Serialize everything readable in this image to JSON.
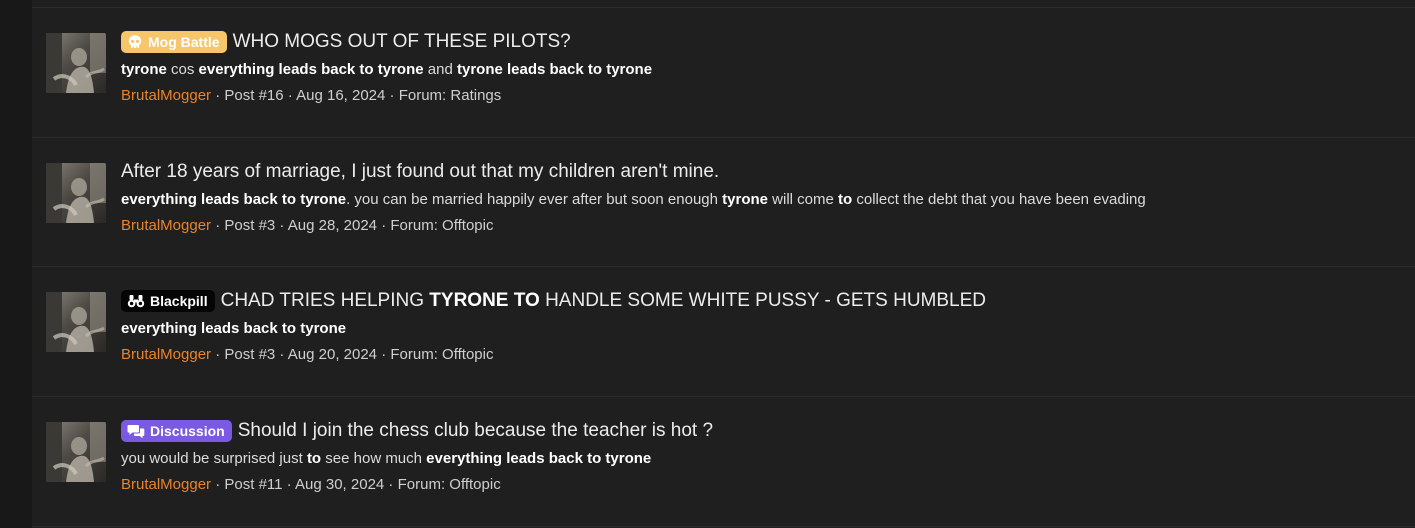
{
  "results": [
    {
      "badge": {
        "label": "Mog Battle",
        "icon": "skull-icon",
        "color": "#f7c66a"
      },
      "title_parts": [
        {
          "text": "WHO MOGS OUT OF THESE PILOTS?",
          "bold": false
        }
      ],
      "snippet_parts": [
        {
          "text": "tyrone",
          "bold": true
        },
        {
          "text": " cos ",
          "bold": false
        },
        {
          "text": "everything leads back to tyrone",
          "bold": true
        },
        {
          "text": " and ",
          "bold": false
        },
        {
          "text": "tyrone leads back to tyrone",
          "bold": true
        }
      ],
      "author": "BrutalMogger",
      "post": "Post #16",
      "date": "Aug 16, 2024",
      "forum": "Forum: Ratings"
    },
    {
      "badge": null,
      "title_parts": [
        {
          "text": "After 18 years of marriage, I just found out that my children aren't mine.",
          "bold": false
        }
      ],
      "snippet_parts": [
        {
          "text": "everything leads back to tyrone",
          "bold": true
        },
        {
          "text": ". you can be married happily ever after but soon enough ",
          "bold": false
        },
        {
          "text": "tyrone",
          "bold": true
        },
        {
          "text": " will come ",
          "bold": false
        },
        {
          "text": "to",
          "bold": true
        },
        {
          "text": " collect the debt that you have been evading",
          "bold": false
        }
      ],
      "author": "BrutalMogger",
      "post": "Post #3",
      "date": "Aug 28, 2024",
      "forum": "Forum: Offtopic"
    },
    {
      "badge": {
        "label": "Blackpill",
        "icon": "binoculars-icon",
        "color": "#050505"
      },
      "title_parts": [
        {
          "text": "CHAD TRIES HELPING ",
          "bold": false
        },
        {
          "text": "TYRONE TO",
          "bold": true
        },
        {
          "text": " HANDLE SOME WHITE PUSSY - GETS HUMBLED",
          "bold": false
        }
      ],
      "snippet_parts": [
        {
          "text": "everything leads back to tyrone",
          "bold": true
        }
      ],
      "author": "BrutalMogger",
      "post": "Post #3",
      "date": "Aug 20, 2024",
      "forum": "Forum: Offtopic"
    },
    {
      "badge": {
        "label": "Discussion",
        "icon": "chat-bubbles-icon",
        "color": "#7a5ae2"
      },
      "title_parts": [
        {
          "text": "Should I join the chess club because the teacher is hot ?",
          "bold": false
        }
      ],
      "snippet_parts": [
        {
          "text": "you would be surprised just ",
          "bold": false
        },
        {
          "text": "to",
          "bold": true
        },
        {
          "text": " see how much ",
          "bold": false
        },
        {
          "text": "everything leads back to tyrone",
          "bold": true
        }
      ],
      "author": "BrutalMogger",
      "post": "Post #11",
      "date": "Aug 30, 2024",
      "forum": "Forum: Offtopic"
    }
  ],
  "separator": " · "
}
